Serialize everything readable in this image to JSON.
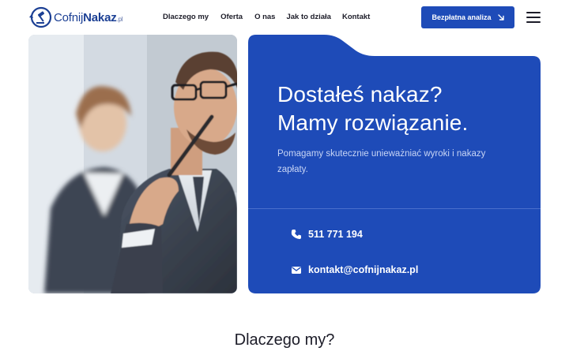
{
  "brand": {
    "name_part1": "Cofnij",
    "name_part2": "Nakaz",
    "suffix": ".pl"
  },
  "nav": {
    "items": [
      {
        "label": "Dlaczego my"
      },
      {
        "label": "Oferta"
      },
      {
        "label": "O nas"
      },
      {
        "label": "Jak to działa"
      },
      {
        "label": "Kontakt"
      }
    ]
  },
  "cta": {
    "label": "Bezpłatna analiza"
  },
  "hero": {
    "title_line1": "Dostałeś nakaz?",
    "title_line2": "Mamy rozwiązanie.",
    "subtitle": "Pomagamy skutecznie unieważniać wyroki i nakazy zapłaty.",
    "phone": "511 771 194",
    "email": "kontakt@cofnijnakaz.pl"
  },
  "sections": {
    "why_title": "Dlaczego my?"
  },
  "colors": {
    "primary": "#1e4bb8",
    "hero_bg": "#1e4bb8",
    "text": "#1c1c28"
  },
  "icons": {
    "logo": "gavel-arrow-logo",
    "cta": "arrow-down-right-icon",
    "menu": "hamburger-menu-icon",
    "phone": "phone-icon",
    "email": "envelope-icon"
  }
}
